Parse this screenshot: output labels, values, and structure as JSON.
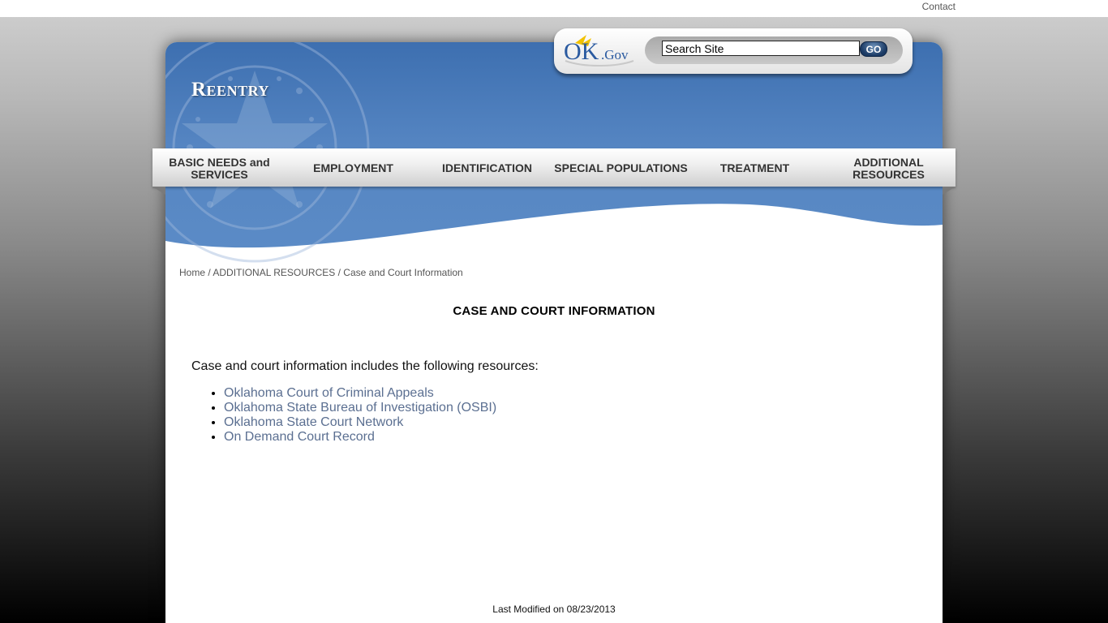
{
  "topbar": {
    "contact": "Contact"
  },
  "header": {
    "site_title": "Reentry",
    "search": {
      "value": "Search Site",
      "go_label": "GO"
    },
    "logo_ok": "OK",
    "logo_gov": ".Gov"
  },
  "nav": {
    "items": [
      {
        "label": "BASIC NEEDS and SERVICES"
      },
      {
        "label": "EMPLOYMENT"
      },
      {
        "label": "IDENTIFICATION"
      },
      {
        "label": "SPECIAL POPULATIONS"
      },
      {
        "label": "TREATMENT"
      },
      {
        "label": "ADDITIONAL RESOURCES"
      }
    ]
  },
  "breadcrumb": {
    "home": "Home",
    "sep1": " / ",
    "section": "ADDITIONAL RESOURCES",
    "sep2": " / ",
    "current": "Case and Court Information"
  },
  "main": {
    "title": "CASE AND COURT INFORMATION",
    "intro": "Case and court information includes the following resources:",
    "links": [
      "Oklahoma Court of Criminal Appeals",
      "Oklahoma State Bureau of Investigation (OSBI)",
      "Oklahoma State Court Network",
      "On Demand Court Record"
    ]
  },
  "footer": {
    "last_modified": "Last Modified on 08/23/2013"
  },
  "colors": {
    "header_blue": "#5585c2",
    "link": "#5b6f91",
    "go_button": "#1b3a64"
  }
}
